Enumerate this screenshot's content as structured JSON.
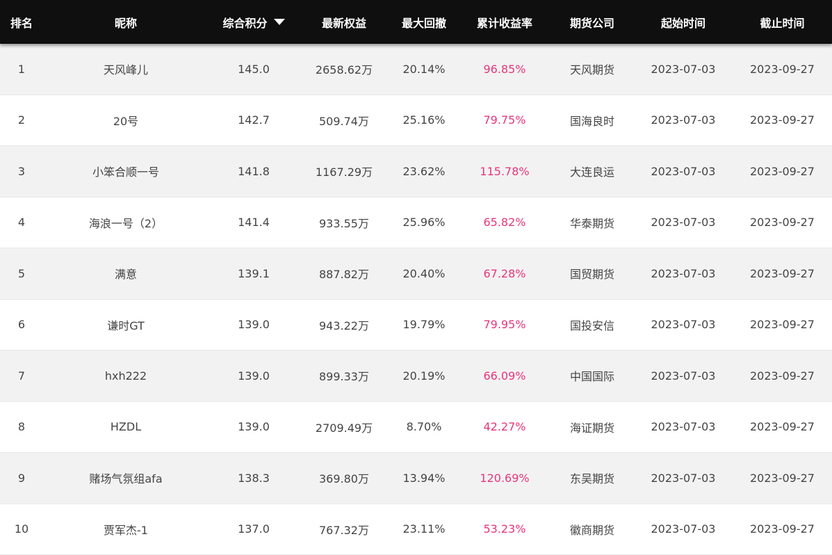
{
  "header": {
    "rank": "排名",
    "nickname": "昵称",
    "score": "综合积分",
    "equity": "最新权益",
    "drawdown": "最大回撤",
    "return_rate": "累计收益率",
    "company": "期货公司",
    "start": "起始时间",
    "end": "截止时间",
    "sort_icon": "caret-down-icon"
  },
  "colors": {
    "header_bg": "#0f0f0f",
    "return_rate": "#e8357a",
    "row_alt": "#f2f2f2"
  },
  "rows": [
    {
      "rank": "1",
      "nickname": "天风峰儿",
      "score": "145.0",
      "equity": "2658.62万",
      "drawdown": "20.14%",
      "return_rate": "96.85%",
      "company": "天风期货",
      "start": "2023-07-03",
      "end": "2023-09-27"
    },
    {
      "rank": "2",
      "nickname": "20号",
      "score": "142.7",
      "equity": "509.74万",
      "drawdown": "25.16%",
      "return_rate": "79.75%",
      "company": "国海良时",
      "start": "2023-07-03",
      "end": "2023-09-27"
    },
    {
      "rank": "3",
      "nickname": "小笨合顺一号",
      "score": "141.8",
      "equity": "1167.29万",
      "drawdown": "23.62%",
      "return_rate": "115.78%",
      "company": "大连良运",
      "start": "2023-07-03",
      "end": "2023-09-27"
    },
    {
      "rank": "4",
      "nickname": "海浪一号（2）",
      "score": "141.4",
      "equity": "933.55万",
      "drawdown": "25.96%",
      "return_rate": "65.82%",
      "company": "华泰期货",
      "start": "2023-07-03",
      "end": "2023-09-27"
    },
    {
      "rank": "5",
      "nickname": "满意",
      "score": "139.1",
      "equity": "887.82万",
      "drawdown": "20.40%",
      "return_rate": "67.28%",
      "company": "国贸期货",
      "start": "2023-07-03",
      "end": "2023-09-27"
    },
    {
      "rank": "6",
      "nickname": "谦时GT",
      "score": "139.0",
      "equity": "943.22万",
      "drawdown": "19.79%",
      "return_rate": "79.95%",
      "company": "国投安信",
      "start": "2023-07-03",
      "end": "2023-09-27"
    },
    {
      "rank": "7",
      "nickname": "hxh222",
      "score": "139.0",
      "equity": "899.33万",
      "drawdown": "20.19%",
      "return_rate": "66.09%",
      "company": "中国国际",
      "start": "2023-07-03",
      "end": "2023-09-27"
    },
    {
      "rank": "8",
      "nickname": "HZDL",
      "score": "139.0",
      "equity": "2709.49万",
      "drawdown": "8.70%",
      "return_rate": "42.27%",
      "company": "海证期货",
      "start": "2023-07-03",
      "end": "2023-09-27"
    },
    {
      "rank": "9",
      "nickname": "赌场气氛组afa",
      "score": "138.3",
      "equity": "369.80万",
      "drawdown": "13.94%",
      "return_rate": "120.69%",
      "company": "东吴期货",
      "start": "2023-07-03",
      "end": "2023-09-27"
    },
    {
      "rank": "10",
      "nickname": "贾军杰-1",
      "score": "137.0",
      "equity": "767.32万",
      "drawdown": "23.11%",
      "return_rate": "53.23%",
      "company": "徽商期货",
      "start": "2023-07-03",
      "end": "2023-09-27"
    }
  ]
}
